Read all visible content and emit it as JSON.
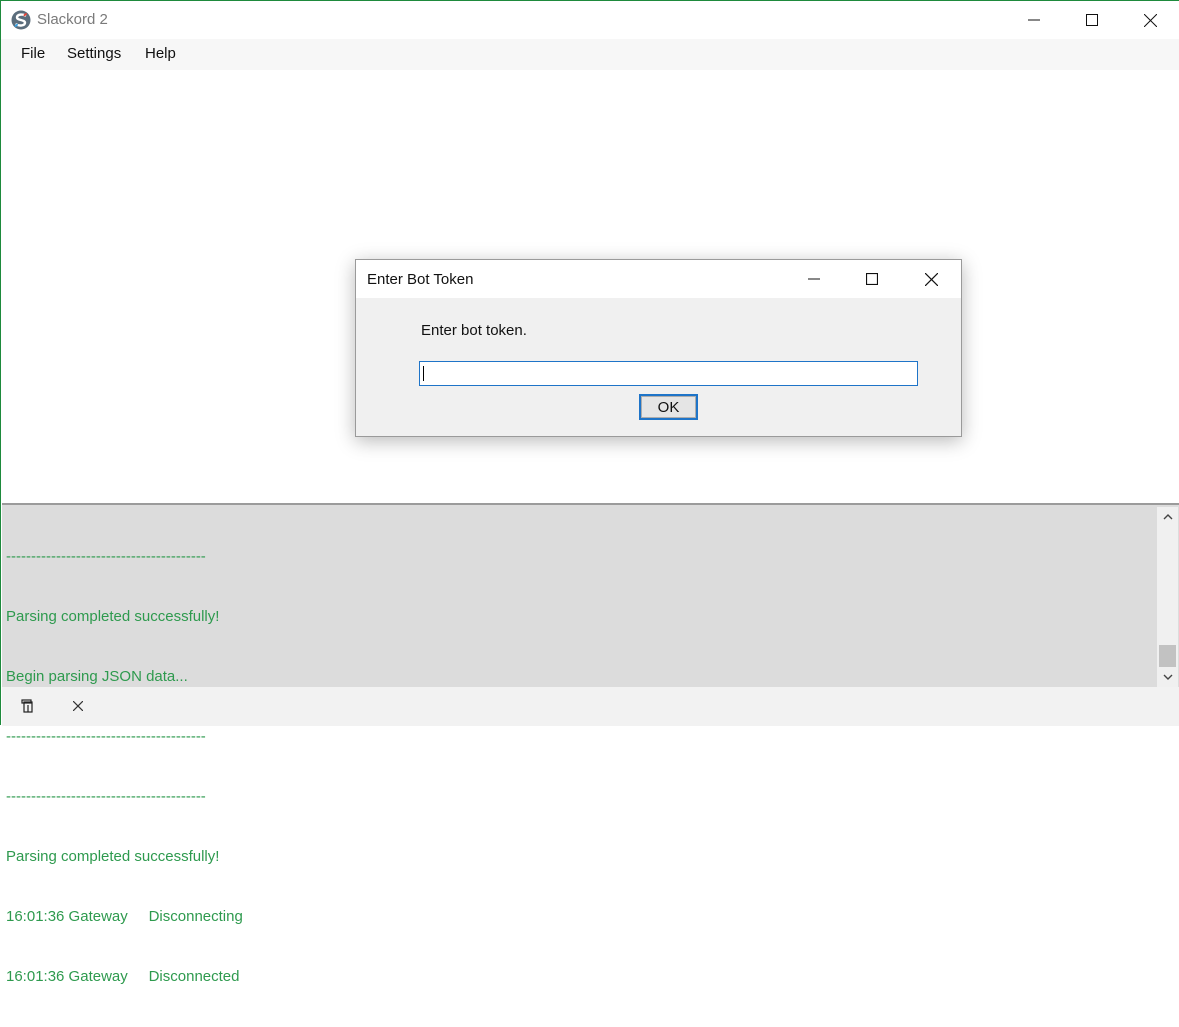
{
  "window": {
    "title": "Slackord 2"
  },
  "menu": {
    "items": [
      {
        "label": "File"
      },
      {
        "label": "Settings"
      },
      {
        "label": "Help"
      }
    ]
  },
  "dialog": {
    "title": "Enter Bot Token",
    "prompt": "Enter bot token.",
    "input_value": "",
    "ok_label": "OK"
  },
  "log": {
    "lines": [
      "----------------------------------------",
      "Parsing completed successfully!",
      "Begin parsing JSON data...",
      "----------------------------------------",
      "----------------------------------------",
      "Parsing completed successfully!",
      "16:01:36 Gateway     Disconnecting",
      "16:01:36 Gateway     Disconnected"
    ],
    "text_color": "#2e9a4e",
    "background": "#dcdcdc"
  },
  "icons": {
    "app": "slackord-logo-icon",
    "minimize": "minimize-icon",
    "maximize": "maximize-icon",
    "close": "close-icon",
    "copy": "copy-icon",
    "clear": "close-icon"
  },
  "colors": {
    "accent": "#1e74c8",
    "window_border": "#1e8a3c"
  }
}
